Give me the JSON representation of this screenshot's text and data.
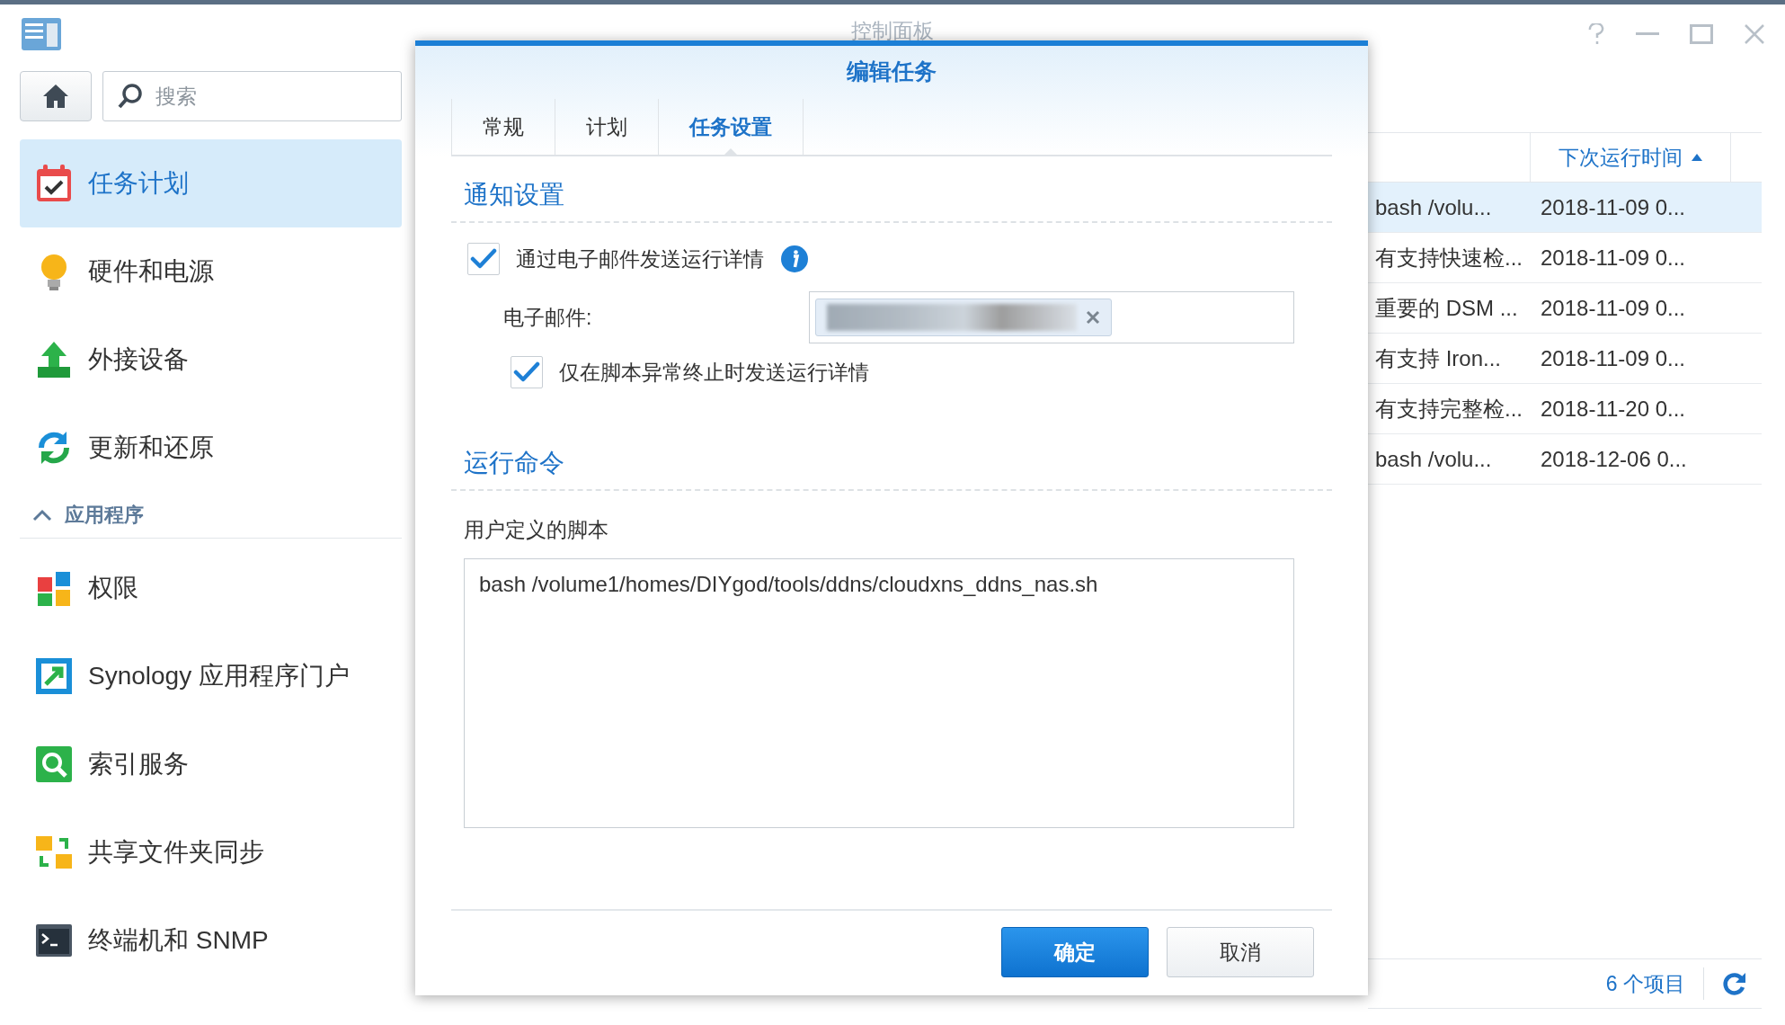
{
  "window": {
    "title": "控制面板"
  },
  "search": {
    "placeholder": "搜索"
  },
  "sidebar": {
    "items": [
      {
        "label": "任务计划",
        "selected": true
      },
      {
        "label": "硬件和电源",
        "selected": false
      },
      {
        "label": "外接设备",
        "selected": false
      },
      {
        "label": "更新和还原",
        "selected": false
      }
    ],
    "section": {
      "label": "应用程序",
      "expanded": true,
      "items": [
        {
          "label": "权限",
          "selected": false
        },
        {
          "label": "Synology 应用程序门户",
          "selected": false
        },
        {
          "label": "索引服务",
          "selected": false
        },
        {
          "label": "共享文件夹同步",
          "selected": false
        },
        {
          "label": "终端机和 SNMP",
          "selected": false
        }
      ]
    }
  },
  "table": {
    "columns": [
      {
        "label": "下次运行时间",
        "sort_ascending": true
      }
    ],
    "rows": [
      {
        "column_1": "bash /volu...",
        "next_run": "2018-11-09 0...",
        "selected": true
      },
      {
        "column_1": "有支持快速检...",
        "next_run": "2018-11-09 0...",
        "selected": false
      },
      {
        "column_1": "重要的 DSM ...",
        "next_run": "2018-11-09 0...",
        "selected": false
      },
      {
        "column_1": "有支持 Iron...",
        "next_run": "2018-11-09 0...",
        "selected": false
      },
      {
        "column_1": "有支持完整检...",
        "next_run": "2018-11-20 0...",
        "selected": false
      },
      {
        "column_1": "bash /volu...",
        "next_run": "2018-12-06 0...",
        "selected": false
      }
    ]
  },
  "status_bar": {
    "count": "6 个项目"
  },
  "dialog": {
    "title": "编辑任务",
    "tabs": [
      {
        "label": "常规",
        "selected": false
      },
      {
        "label": "计划",
        "selected": false
      },
      {
        "label": "任务设置",
        "selected": true
      }
    ],
    "notification": {
      "heading": "通知设置",
      "send_email": {
        "label": "通过电子邮件发送运行详情",
        "checked": true
      },
      "email_label": "电子邮件:",
      "only_on_error": {
        "label": "仅在脚本异常终止时发送运行详情",
        "checked": true
      }
    },
    "command": {
      "heading": "运行命令",
      "label": "用户定义的脚本",
      "value": "bash /volume1/homes/DIYgod/tools/ddns/cloudxns_ddns_nas.sh"
    },
    "buttons": [
      {
        "label": "确定",
        "kind": "primary"
      },
      {
        "label": "取消",
        "kind": "secondary"
      }
    ]
  }
}
